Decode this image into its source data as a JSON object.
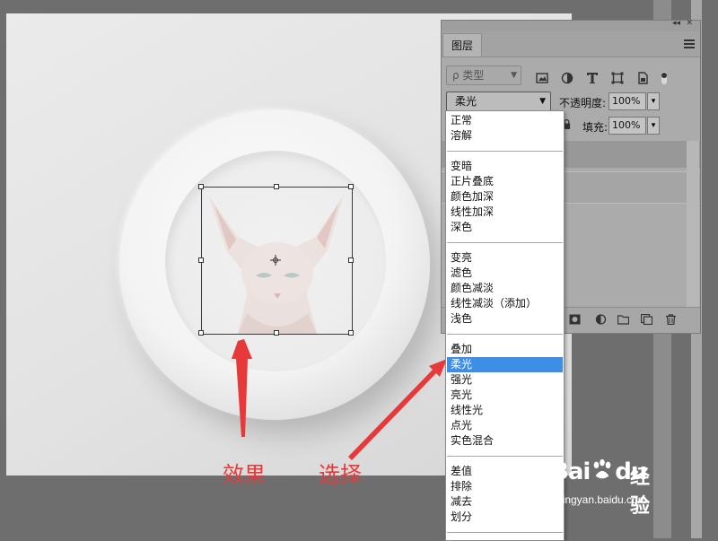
{
  "panel": {
    "tab_title": "图层",
    "kind_filter_label": "ρ 类型",
    "blend_mode": "柔光",
    "opacity_label": "不透明度:",
    "opacity_value": "100%",
    "fill_label": "填充:",
    "fill_value": "100%"
  },
  "dropdown": {
    "groups": [
      [
        "正常",
        "溶解"
      ],
      [
        "变暗",
        "正片叠底",
        "颜色加深",
        "线性加深",
        "深色"
      ],
      [
        "变亮",
        "滤色",
        "颜色减淡",
        "线性减淡（添加）",
        "浅色"
      ],
      [
        "叠加",
        "柔光",
        "强光",
        "亮光",
        "线性光",
        "点光",
        "实色混合"
      ],
      [
        "差值",
        "排除",
        "减去",
        "划分"
      ]
    ],
    "selected": "柔光"
  },
  "annotations": {
    "effect": "效果",
    "select": "选择"
  },
  "watermark": {
    "logo": "Bai",
    "logo_suffix": "du",
    "text": "经验",
    "url": "jingyan.baidu.com"
  },
  "colors": {
    "annotation_red": "#e8393a",
    "selection_blue": "#3d8ee6"
  },
  "icons": [
    "image-filter-icon",
    "adjustment-filter-icon",
    "type-filter-icon",
    "shape-filter-icon",
    "smart-object-filter-icon",
    "filter-toggle-icon",
    "panel-menu-icon",
    "lock-icon",
    "mask-icon",
    "adjustment-layer-icon",
    "group-folder-icon",
    "new-layer-icon",
    "trash-icon"
  ]
}
